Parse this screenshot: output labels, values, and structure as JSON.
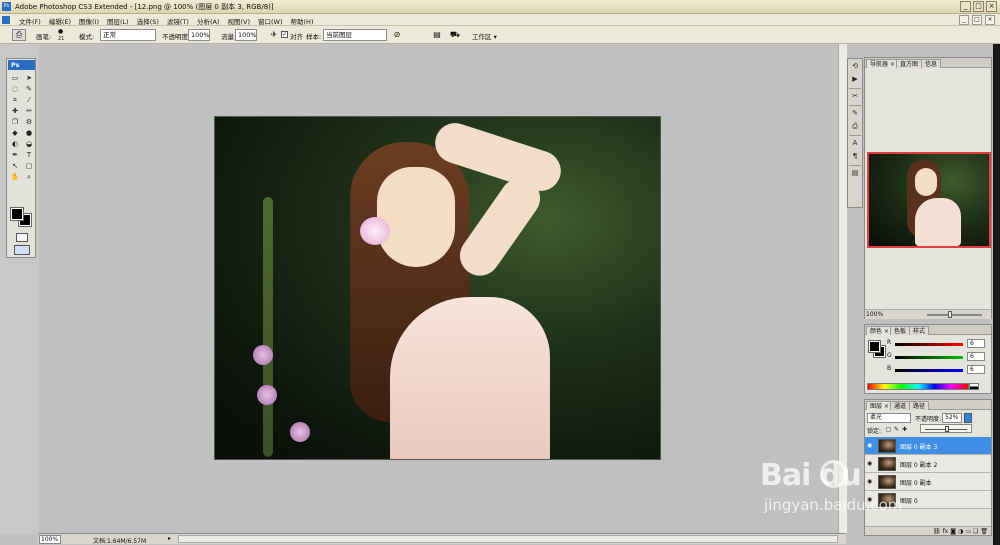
{
  "window": {
    "title": "Adobe Photoshop CS3 Extended - [12.png @ 100% (图层 0 副本 3, RGB/8)]",
    "controls": [
      "_",
      "□",
      "×"
    ]
  },
  "menubar": {
    "items": [
      "文件(F)",
      "编辑(E)",
      "图像(I)",
      "图层(L)",
      "选择(S)",
      "滤镜(T)",
      "分析(A)",
      "视图(V)",
      "窗口(W)",
      "帮助(H)"
    ],
    "doc_controls": [
      "_",
      "□",
      "×"
    ]
  },
  "options": {
    "brush_label": "画笔:",
    "brush_size": "21",
    "mode_label": "模式:",
    "mode_value": "正常",
    "opacity_label": "不透明度:",
    "opacity_value": "100%",
    "flow_label": "流量:",
    "flow_value": "100%",
    "aligned_label": "对齐",
    "sample_label": "样本:",
    "sample_value": "当前图层",
    "workspace_label": "工作区 ▾"
  },
  "toolbox": {
    "header": "Ps",
    "tools": [
      "▭",
      "➤",
      "◌",
      "✎",
      "⌗",
      "⁄",
      "✚",
      "✏",
      "❐",
      "⚙",
      "◆",
      "●",
      "◐",
      "◒",
      "✒",
      "T",
      "↖",
      "▢",
      "✋",
      "⌕"
    ]
  },
  "navigator": {
    "tabs": [
      "导航器 ×",
      "直方图",
      "信息"
    ],
    "zoom": "100%"
  },
  "color_panel": {
    "tabs": [
      "颜色 ×",
      "色板",
      "样式"
    ],
    "channels": [
      {
        "label": "R",
        "value": "6",
        "gradient": "linear-gradient(90deg,#000,#ff0000)"
      },
      {
        "label": "G",
        "value": "6",
        "gradient": "linear-gradient(90deg,#000,#00c000)"
      },
      {
        "label": "B",
        "value": "6",
        "gradient": "linear-gradient(90deg,#000,#0000ff)"
      }
    ]
  },
  "layers_panel": {
    "tabs": [
      "图层 ×",
      "通道",
      "路径"
    ],
    "blend_mode": "柔光",
    "opacity_label": "不透明度:",
    "opacity_value": "52%",
    "opacity_slider_fraction": 0.52,
    "lock_label": "锁定:",
    "layers": [
      {
        "name": "图层 0 副本 3",
        "selected": true
      },
      {
        "name": "图层 0 副本 2",
        "selected": false
      },
      {
        "name": "图层 0 副本",
        "selected": false
      },
      {
        "name": "图层 0",
        "selected": false
      }
    ],
    "footer_icons": [
      "⛓",
      "fx",
      "◙",
      "◑",
      "▭",
      "❏",
      "🗑"
    ]
  },
  "statusbar": {
    "zoom": "100%",
    "doc_info": "文档:1.64M/6.57M"
  },
  "watermark": {
    "brand": "Bai  du",
    "url": "jingyan.baidu.com"
  }
}
